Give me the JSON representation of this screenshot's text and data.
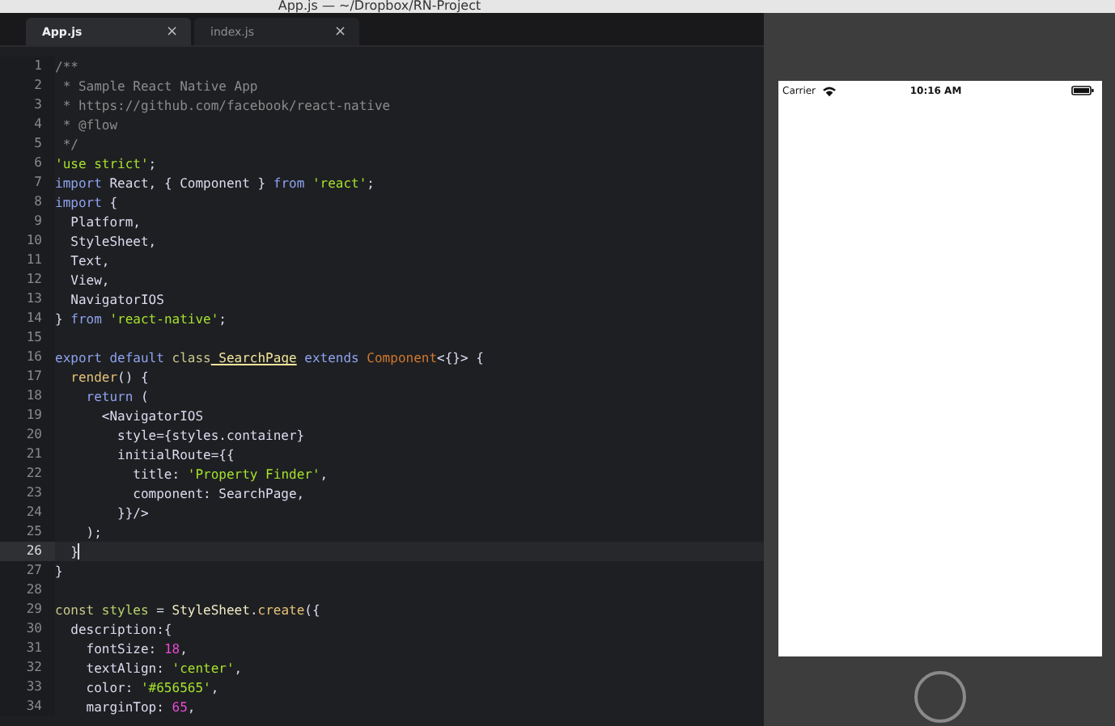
{
  "window": {
    "title": "App.js — ~/Dropbox/RN-Project"
  },
  "tabs": [
    {
      "label": "App.js",
      "close": "×",
      "selected": true
    },
    {
      "label": "index.js",
      "close": "×",
      "selected": false
    }
  ],
  "editor": {
    "lines": [
      {
        "number": "1",
        "current": false,
        "tokens": [
          {
            "kind": "comment",
            "text": "/**"
          }
        ]
      },
      {
        "number": "2",
        "current": false,
        "tokens": [
          {
            "kind": "comment",
            "text": " * Sample React Native App"
          }
        ]
      },
      {
        "number": "3",
        "current": false,
        "tokens": [
          {
            "kind": "comment",
            "text": " * https://github.com/facebook/react-native"
          }
        ]
      },
      {
        "number": "4",
        "current": false,
        "tokens": [
          {
            "kind": "comment",
            "text": " * @flow"
          }
        ]
      },
      {
        "number": "5",
        "current": false,
        "tokens": [
          {
            "kind": "comment",
            "text": " */"
          }
        ]
      },
      {
        "number": "6",
        "current": false,
        "tokens": [
          {
            "kind": "string",
            "text": "'use strict'"
          },
          {
            "kind": "plain",
            "text": ";"
          }
        ]
      },
      {
        "number": "7",
        "current": false,
        "tokens": [
          {
            "kind": "keyword",
            "text": "import"
          },
          {
            "kind": "plain",
            "text": " React, { Component } "
          },
          {
            "kind": "keyword",
            "text": "from"
          },
          {
            "kind": "string",
            "text": " 'react'"
          },
          {
            "kind": "plain",
            "text": ";"
          }
        ]
      },
      {
        "number": "8",
        "current": false,
        "tokens": [
          {
            "kind": "keyword",
            "text": "import"
          },
          {
            "kind": "plain",
            "text": " {"
          }
        ]
      },
      {
        "number": "9",
        "current": false,
        "tokens": [
          {
            "kind": "plain",
            "text": "  Platform,"
          }
        ]
      },
      {
        "number": "10",
        "current": false,
        "tokens": [
          {
            "kind": "plain",
            "text": "  StyleSheet,"
          }
        ]
      },
      {
        "number": "11",
        "current": false,
        "tokens": [
          {
            "kind": "plain",
            "text": "  Text,"
          }
        ]
      },
      {
        "number": "12",
        "current": false,
        "tokens": [
          {
            "kind": "plain",
            "text": "  View,"
          }
        ]
      },
      {
        "number": "13",
        "current": false,
        "tokens": [
          {
            "kind": "plain",
            "text": "  NavigatorIOS"
          }
        ]
      },
      {
        "number": "14",
        "current": false,
        "tokens": [
          {
            "kind": "plain",
            "text": "} "
          },
          {
            "kind": "keyword",
            "text": "from"
          },
          {
            "kind": "string",
            "text": " 'react-native'"
          },
          {
            "kind": "plain",
            "text": ";"
          }
        ]
      },
      {
        "number": "15",
        "current": false
      },
      {
        "number": "16",
        "current": false,
        "tokens": [
          {
            "kind": "keyword",
            "text": "export default"
          },
          {
            "kind": "storage",
            "text": " class"
          },
          {
            "kind": "classname",
            "text": " SearchPage"
          },
          {
            "kind": "keyword",
            "text": " extends"
          },
          {
            "kind": "inherited",
            "text": " Component"
          },
          {
            "kind": "plain",
            "text": "<{}> {"
          }
        ]
      },
      {
        "number": "17",
        "current": false,
        "tokens": [
          {
            "kind": "func",
            "text": "  render"
          },
          {
            "kind": "plain",
            "text": "() {"
          }
        ]
      },
      {
        "number": "18",
        "current": false,
        "tokens": [
          {
            "kind": "keyword",
            "text": "    return"
          },
          {
            "kind": "plain",
            "text": " ("
          }
        ]
      },
      {
        "number": "19",
        "current": false,
        "tokens": [
          {
            "kind": "plain",
            "text": "      <NavigatorIOS"
          }
        ]
      },
      {
        "number": "20",
        "current": false,
        "tokens": [
          {
            "kind": "plain",
            "text": "        style={styles.container}"
          }
        ]
      },
      {
        "number": "21",
        "current": false,
        "tokens": [
          {
            "kind": "plain",
            "text": "        initialRoute={{"
          }
        ]
      },
      {
        "number": "22",
        "current": false,
        "tokens": [
          {
            "kind": "plain",
            "text": "          title: "
          },
          {
            "kind": "string",
            "text": "'Property Finder'"
          },
          {
            "kind": "plain",
            "text": ","
          }
        ]
      },
      {
        "number": "23",
        "current": false,
        "tokens": [
          {
            "kind": "plain",
            "text": "          component: SearchPage,"
          }
        ]
      },
      {
        "number": "24",
        "current": false,
        "tokens": [
          {
            "kind": "plain",
            "text": "        }}/>"
          }
        ]
      },
      {
        "number": "25",
        "current": false,
        "tokens": [
          {
            "kind": "plain",
            "text": "    );"
          }
        ]
      },
      {
        "number": "26",
        "current": true,
        "tokens": [
          {
            "kind": "plain",
            "text": "  }"
          }
        ]
      },
      {
        "number": "27",
        "current": false,
        "tokens": [
          {
            "kind": "plain",
            "text": "}"
          }
        ]
      },
      {
        "number": "28",
        "current": false
      },
      {
        "number": "29",
        "current": false,
        "tokens": [
          {
            "kind": "storage",
            "text": "const"
          },
          {
            "kind": "variable",
            "text": " styles"
          },
          {
            "kind": "plain",
            "text": " = "
          },
          {
            "kind": "support",
            "text": "StyleSheet"
          },
          {
            "kind": "plain",
            "text": "."
          },
          {
            "kind": "func",
            "text": "create"
          },
          {
            "kind": "plain",
            "text": "({"
          }
        ]
      },
      {
        "number": "30",
        "current": false,
        "tokens": [
          {
            "kind": "plain",
            "text": "  description:{"
          }
        ]
      },
      {
        "number": "31",
        "current": false,
        "tokens": [
          {
            "kind": "plain",
            "text": "    fontSize: "
          },
          {
            "kind": "number",
            "text": "18"
          },
          {
            "kind": "plain",
            "text": ","
          }
        ]
      },
      {
        "number": "32",
        "current": false,
        "tokens": [
          {
            "kind": "plain",
            "text": "    textAlign: "
          },
          {
            "kind": "string",
            "text": "'center'"
          },
          {
            "kind": "plain",
            "text": ","
          }
        ]
      },
      {
        "number": "33",
        "current": false,
        "tokens": [
          {
            "kind": "plain",
            "text": "    color: "
          },
          {
            "kind": "string",
            "text": "'#656565'"
          },
          {
            "kind": "plain",
            "text": ","
          }
        ]
      },
      {
        "number": "34",
        "current": false,
        "tokens": [
          {
            "kind": "plain",
            "text": "    marginTop: "
          },
          {
            "kind": "number",
            "text": "65"
          },
          {
            "kind": "plain",
            "text": ","
          }
        ]
      }
    ]
  },
  "simulator": {
    "carrier": "Carrier",
    "time": "10:16 AM"
  }
}
